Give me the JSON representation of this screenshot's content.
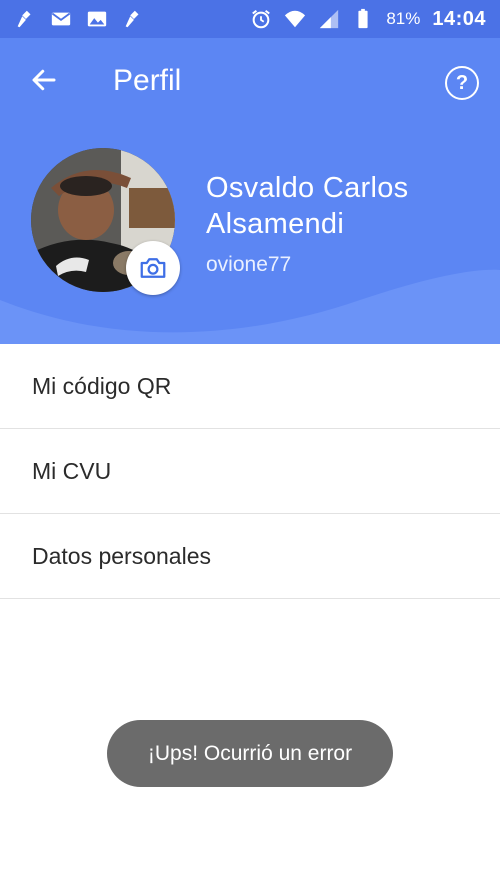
{
  "status_bar": {
    "battery": "81%",
    "time": "14:04",
    "icons": [
      "broom-icon",
      "mail-icon",
      "image-icon",
      "broom-icon",
      "alarm-icon",
      "wifi-icon",
      "signal-icon",
      "battery-icon"
    ]
  },
  "toolbar": {
    "title": "Perfil",
    "back_icon": "arrow-left-icon",
    "help_icon": "question-circle-icon"
  },
  "profile": {
    "name": "Osvaldo Carlos Alsamendi",
    "username": "ovione77",
    "camera_icon": "camera-icon"
  },
  "menu": {
    "items": [
      {
        "label": "Mi código QR"
      },
      {
        "label": "Mi CVU"
      },
      {
        "label": "Datos personales"
      }
    ]
  },
  "toast": {
    "message": "¡Ups! Ocurrió un error"
  },
  "colors": {
    "status_bar": "#4b72e6",
    "header": "#5c86f3",
    "header_wave": "#6b93f7",
    "toast": "#6b6b6b"
  }
}
